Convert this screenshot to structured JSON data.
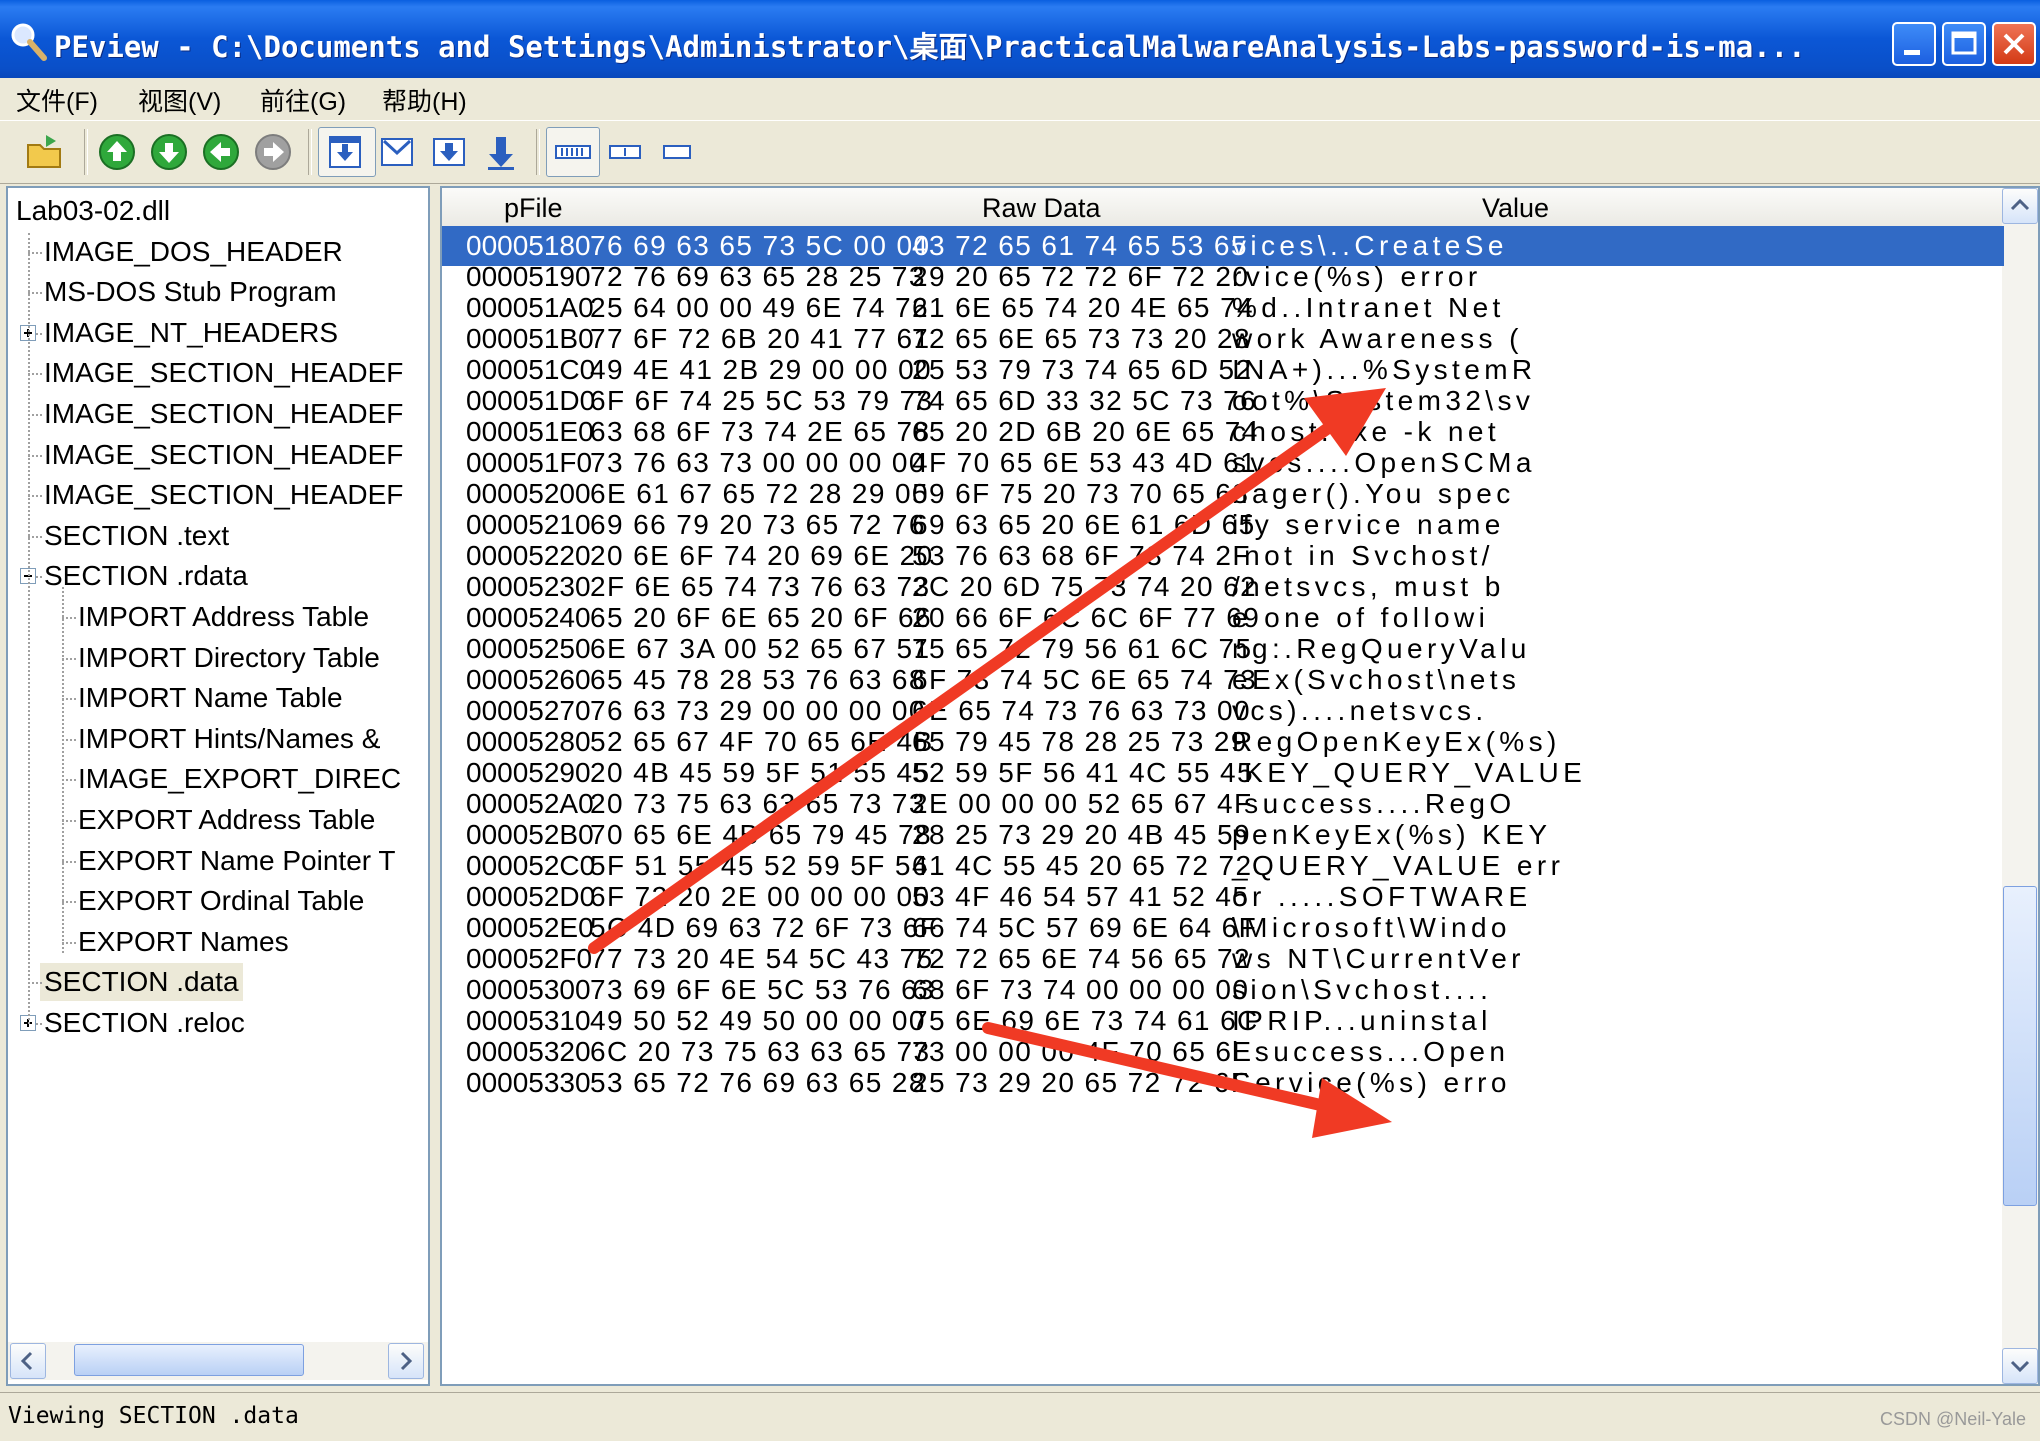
{
  "window": {
    "title": "PEview - C:\\Documents and Settings\\Administrator\\桌面\\PracticalMalwareAnalysis-Labs-password-is-ma..."
  },
  "menu": [
    "文件(F)",
    "视图(V)",
    "前往(G)",
    "帮助(H)"
  ],
  "tree": {
    "root": "Lab03-02.dll",
    "items": [
      "IMAGE_DOS_HEADER",
      "MS-DOS Stub Program",
      "IMAGE_NT_HEADERS",
      "IMAGE_SECTION_HEADEF",
      "IMAGE_SECTION_HEADEF",
      "IMAGE_SECTION_HEADEF",
      "IMAGE_SECTION_HEADEF",
      "SECTION .text",
      "SECTION .rdata",
      "IMPORT Address Table",
      "IMPORT Directory Table",
      "IMPORT Name Table",
      "IMPORT Hints/Names &",
      "IMAGE_EXPORT_DIREC",
      "EXPORT Address Table",
      "EXPORT Name Pointer T",
      "EXPORT Ordinal Table",
      "EXPORT Names",
      "SECTION .data",
      "SECTION .reloc"
    ]
  },
  "columns": {
    "pfile": "pFile",
    "raw": "Raw Data",
    "value": "Value"
  },
  "rows": [
    {
      "addr": "00005180",
      "raw1": "76 69 63 65 73 5C 00 00",
      "raw2": "43 72 65 61 74 65 53 65",
      "value": "vices\\..CreateSe"
    },
    {
      "addr": "00005190",
      "raw1": "72 76 69 63 65 28 25 73",
      "raw2": "29 20 65 72 72 6F 72 20",
      "value": "rvice(%s) error "
    },
    {
      "addr": "000051A0",
      "raw1": "25 64 00 00 49 6E 74 72",
      "raw2": "61 6E 65 74 20 4E 65 74",
      "value": "%d..Intranet Net"
    },
    {
      "addr": "000051B0",
      "raw1": "77 6F 72 6B 20 41 77 61",
      "raw2": "72 65 6E 65 73 73 20 28",
      "value": "work Awareness ("
    },
    {
      "addr": "000051C0",
      "raw1": "49 4E 41 2B 29 00 00 00",
      "raw2": "25 53 79 73 74 65 6D 52",
      "value": "INA+)...%SystemR"
    },
    {
      "addr": "000051D0",
      "raw1": "6F 6F 74 25 5C 53 79 73",
      "raw2": "74 65 6D 33 32 5C 73 76",
      "value": "oot%\\System32\\sv"
    },
    {
      "addr": "000051E0",
      "raw1": "63 68 6F 73 74 2E 65 78",
      "raw2": "65 20 2D 6B 20 6E 65 74",
      "value": "chost.exe -k net"
    },
    {
      "addr": "000051F0",
      "raw1": "73 76 63 73 00 00 00 00",
      "raw2": "4F 70 65 6E 53 43 4D 61",
      "value": "svcs....OpenSCMa"
    },
    {
      "addr": "00005200",
      "raw1": "6E 61 67 65 72 28 29 00",
      "raw2": "59 6F 75 20 73 70 65 63",
      "value": "nager().You spec"
    },
    {
      "addr": "00005210",
      "raw1": "69 66 79 20 73 65 72 76",
      "raw2": "69 63 65 20 6E 61 6D 65",
      "value": "ify service name"
    },
    {
      "addr": "00005220",
      "raw1": "20 6E 6F 74 20 69 6E 20",
      "raw2": "53 76 63 68 6F 73 74 2F",
      "value": " not in Svchost/"
    },
    {
      "addr": "00005230",
      "raw1": "2F 6E 65 74 73 76 63 73",
      "raw2": "2C 20 6D 75 73 74 20 62",
      "value": "/netsvcs, must b"
    },
    {
      "addr": "00005240",
      "raw1": "65 20 6F 6E 65 20 6F 66",
      "raw2": "20 66 6F 6C 6C 6F 77 69",
      "value": "e one of followi"
    },
    {
      "addr": "00005250",
      "raw1": "6E 67 3A 00 52 65 67 51",
      "raw2": "75 65 72 79 56 61 6C 75",
      "value": "ng:.RegQueryValu"
    },
    {
      "addr": "00005260",
      "raw1": "65 45 78 28 53 76 63 68",
      "raw2": "6F 73 74 5C 6E 65 74 73",
      "value": "eEx(Svchost\\nets"
    },
    {
      "addr": "00005270",
      "raw1": "76 63 73 29 00 00 00 00",
      "raw2": "6E 65 74 73 76 63 73 00",
      "value": "vcs)....netsvcs."
    },
    {
      "addr": "00005280",
      "raw1": "52 65 67 4F 70 65 6E 4B",
      "raw2": "65 79 45 78 28 25 73 29",
      "value": "RegOpenKeyEx(%s)"
    },
    {
      "addr": "00005290",
      "raw1": "20 4B 45 59 5F 51 55 45",
      "raw2": "52 59 5F 56 41 4C 55 45",
      "value": " KEY_QUERY_VALUE"
    },
    {
      "addr": "000052A0",
      "raw1": "20 73 75 63 63 65 73 73",
      "raw2": "2E 00 00 00 52 65 67 4F",
      "value": " success....RegO"
    },
    {
      "addr": "000052B0",
      "raw1": "70 65 6E 4B 65 79 45 78",
      "raw2": "28 25 73 29 20 4B 45 59",
      "value": "penKeyEx(%s) KEY"
    },
    {
      "addr": "000052C0",
      "raw1": "5F 51 55 45 52 59 5F 56",
      "raw2": "41 4C 55 45 20 65 72 72",
      "value": "_QUERY_VALUE err"
    },
    {
      "addr": "000052D0",
      "raw1": "6F 72 20 2E 00 00 00 00",
      "raw2": "53 4F 46 54 57 41 52 45",
      "value": "or .....SOFTWARE"
    },
    {
      "addr": "000052E0",
      "raw1": "5C 4D 69 63 72 6F 73 6F",
      "raw2": "66 74 5C 57 69 6E 64 6F",
      "value": "\\Microsoft\\Windo"
    },
    {
      "addr": "000052F0",
      "raw1": "77 73 20 4E 54 5C 43 75",
      "raw2": "72 72 65 6E 74 56 65 72",
      "value": "ws NT\\CurrentVer"
    },
    {
      "addr": "00005300",
      "raw1": "73 69 6F 6E 5C 53 76 63",
      "raw2": "68 6F 73 74 00 00 00 00",
      "value": "sion\\Svchost...."
    },
    {
      "addr": "00005310",
      "raw1": "49 50 52 49 50 00 00 00",
      "raw2": "75 6E 69 6E 73 74 61 6C",
      "value": "IPRIP...uninstal"
    },
    {
      "addr": "00005320",
      "raw1": "6C 20 73 75 63 63 65 73",
      "raw2": "73 00 00 00 4F 70 65 6E",
      "value": "l success...Open"
    },
    {
      "addr": "00005330",
      "raw1": "53 65 72 76 69 63 65 28",
      "raw2": "25 73 29 20 65 72 72 6F",
      "value": "Service(%s) erro"
    }
  ],
  "status": "Viewing SECTION .data",
  "watermark": "CSDN @Neil-Yale",
  "colors": {
    "selection": "#316ac5",
    "annotation_arrow": "#f03a24"
  }
}
